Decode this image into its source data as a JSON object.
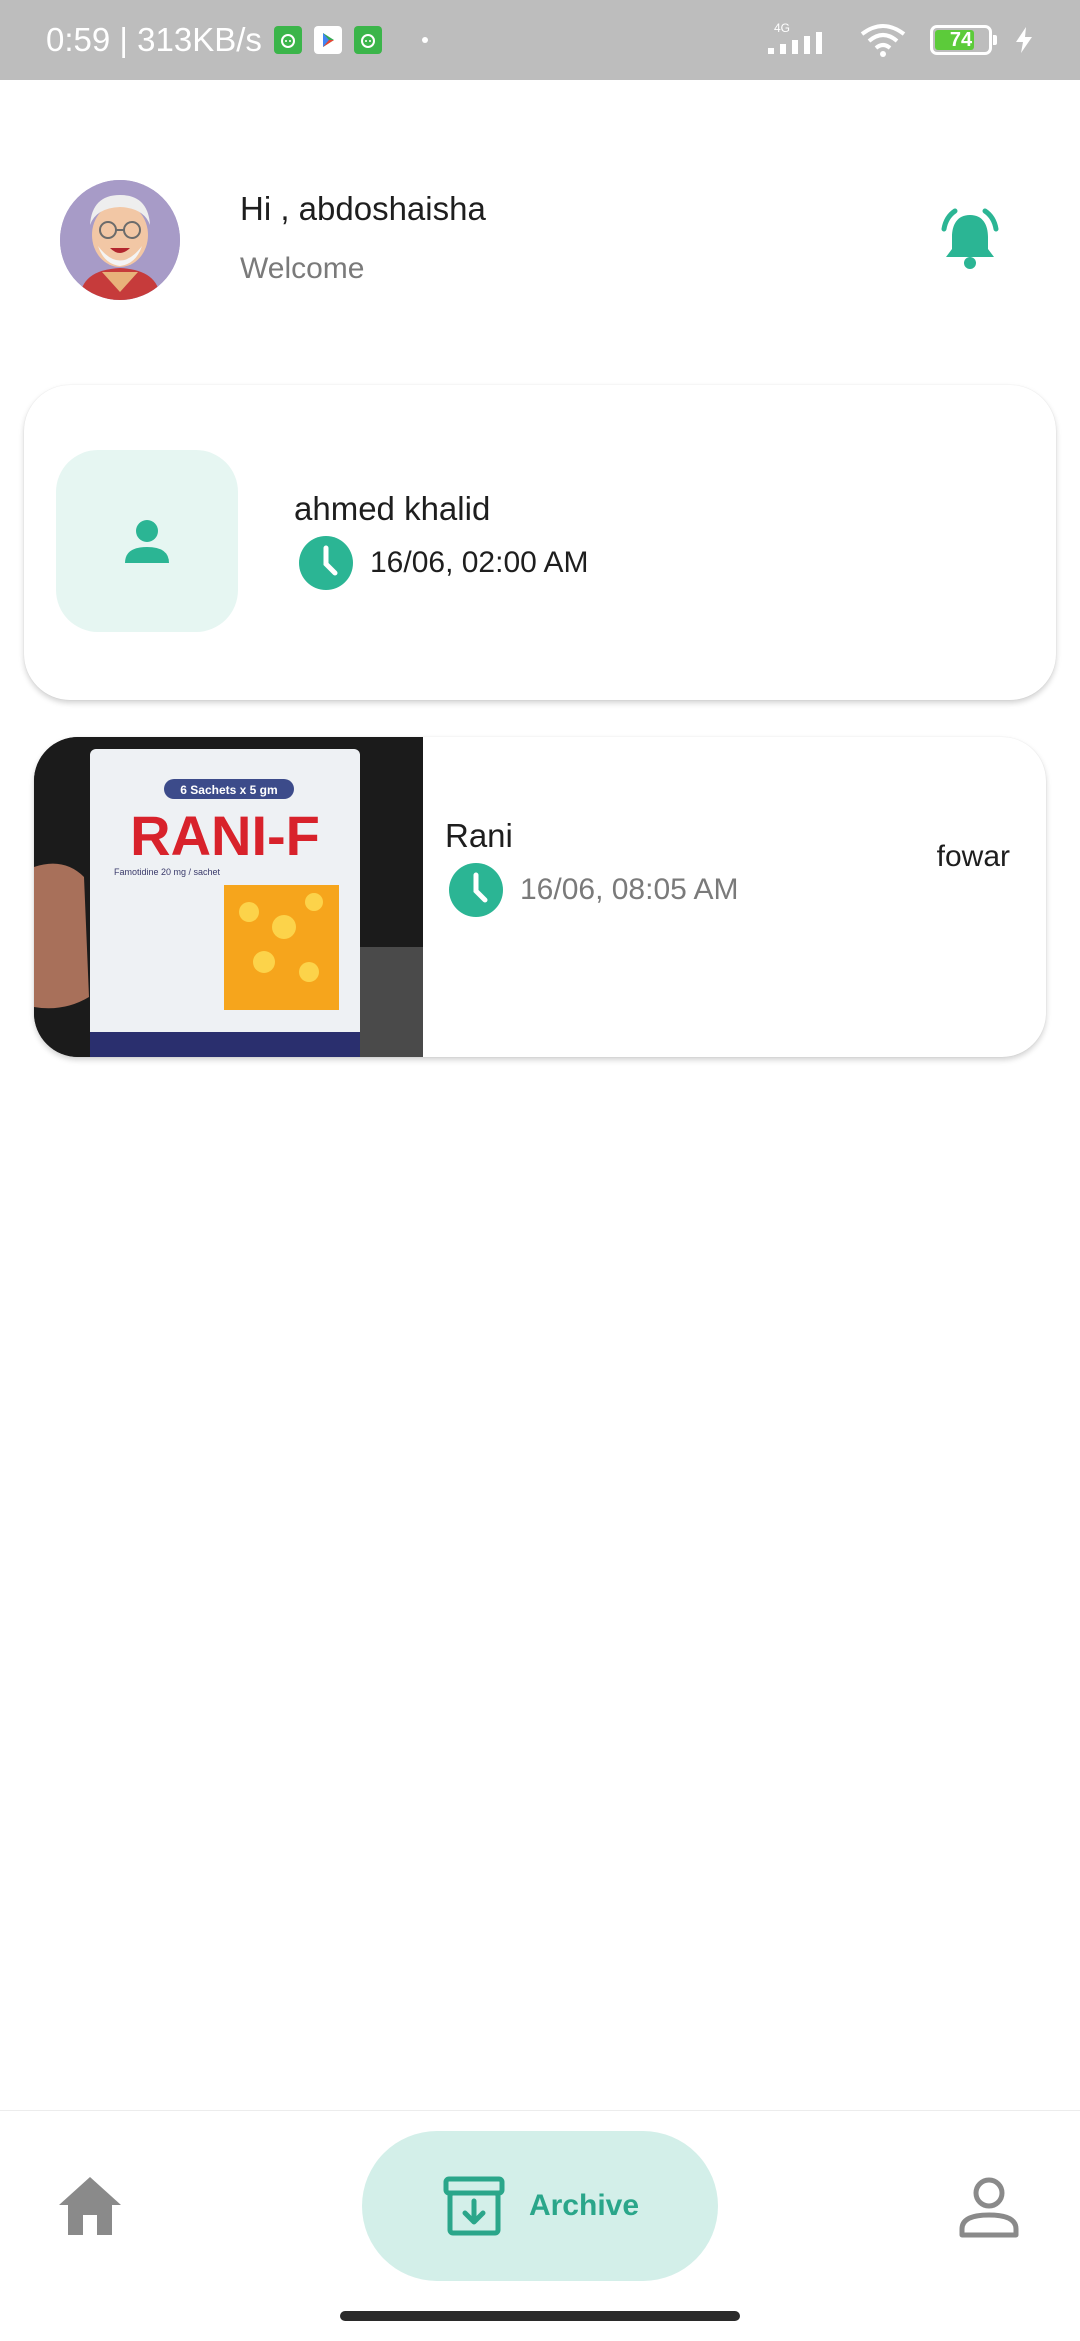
{
  "status_bar": {
    "time_speed": "0:59 | 313KB/s",
    "network": "4G",
    "battery_level": "74"
  },
  "header": {
    "greeting": "Hi , abdoshaisha",
    "subtitle": "Welcome"
  },
  "colors": {
    "accent": "#2bb594",
    "accent_light": "#e6f6f2",
    "archive_bg": "#d3efe9",
    "nav_icon": "#8a8a8a"
  },
  "cards": [
    {
      "type": "person",
      "name": "ahmed khalid",
      "datetime": "16/06,  02:00 AM",
      "icon": "person-icon"
    },
    {
      "type": "medicine",
      "title": "Rani",
      "datetime": "16/06, 08:05 AM",
      "tag": "fowar",
      "image": {
        "box_top_text": "6 Sachets x 5 gm",
        "brand": "RANI-F",
        "subtext": "Famotidine 20 mg / sachet"
      }
    }
  ],
  "bottom_nav": {
    "items": [
      {
        "name": "home",
        "icon": "home-icon",
        "active": false
      },
      {
        "name": "archive",
        "label": "Archive",
        "icon": "archive-icon",
        "active": true
      },
      {
        "name": "profile",
        "icon": "profile-icon",
        "active": false
      }
    ]
  }
}
